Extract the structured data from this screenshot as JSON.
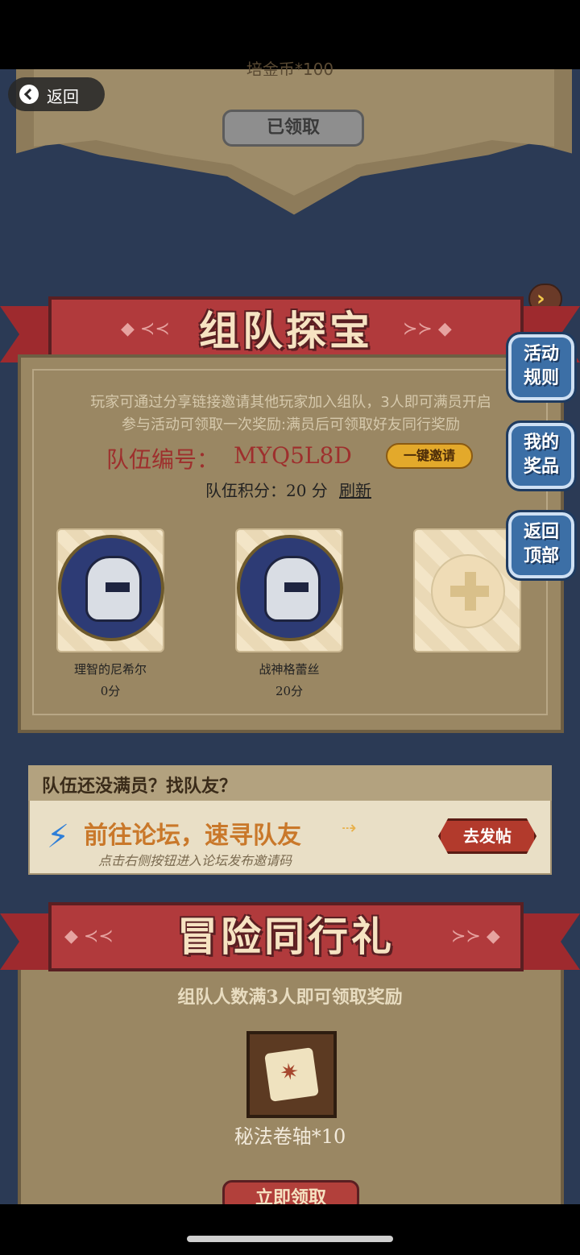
{
  "top_panel": {
    "partial_text": "培金币*100",
    "claimed_button": "已领取"
  },
  "back": {
    "label": "返回"
  },
  "team_section": {
    "title": "组队探宝",
    "description_line1": "玩家可通过分享链接邀请其他玩家加入组队，3人即可满员开启",
    "description_line2": "参与活动可领取一次奖励:满员后可领取好友同行奖励",
    "team_id_label": "队伍编号：",
    "team_id": "MYQ5L8D",
    "invite_button": "一键邀请",
    "score_label": "队伍积分：",
    "score_value": "20 分",
    "refresh": "刷新",
    "members": [
      {
        "name": "理智的尼希尔",
        "score": "0分"
      },
      {
        "name": "战神格蕾丝",
        "score": "20分"
      }
    ]
  },
  "side_buttons": {
    "rules_l1": "活动",
    "rules_l2": "规则",
    "prizes_l1": "我的",
    "prizes_l2": "奖品",
    "top_l1": "返回",
    "top_l2": "顶部"
  },
  "forum": {
    "header": "队伍还没满员？找队友？",
    "title": "前往论坛，速寻队友",
    "subtitle": "点击右侧按钮进入论坛发布邀请码",
    "post_button": "去发帖"
  },
  "adventure": {
    "title": "冒险同行礼",
    "description": "组队人数满3人即可领取奖励",
    "reward_label": "秘法卷轴*10",
    "claim_button": "立即领取"
  },
  "colors": {
    "background": "#2b3a55",
    "ribbon": "#b13a3c",
    "parchment": "#9a8763",
    "accent_gold": "#e3a92b",
    "team_id_red": "#9e2f2d"
  }
}
